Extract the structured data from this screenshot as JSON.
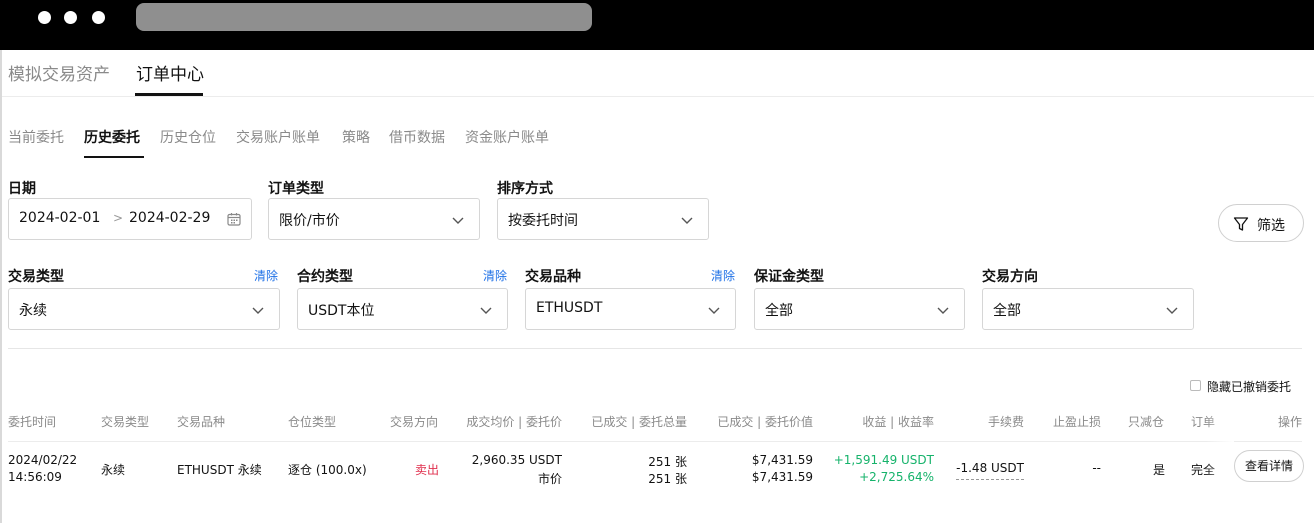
{
  "main_tabs": [
    {
      "label": "模拟交易资产",
      "active": false
    },
    {
      "label": "订单中心",
      "active": true
    }
  ],
  "sub_tabs": [
    {
      "label": "当前委托",
      "active": false
    },
    {
      "label": "历史委托",
      "active": true
    },
    {
      "label": "历史仓位",
      "active": false
    },
    {
      "label": "交易账户账单",
      "active": false
    },
    {
      "label": "策略",
      "active": false
    },
    {
      "label": "借币数据",
      "active": false
    },
    {
      "label": "资金账户账单",
      "active": false
    }
  ],
  "filters": {
    "date": {
      "label": "日期",
      "start": "2024-02-01",
      "separator": ">",
      "end": "2024-02-29",
      "icon": "calendar-icon"
    },
    "order_type": {
      "label": "订单类型",
      "value": "限价/市价"
    },
    "sort": {
      "label": "排序方式",
      "value": "按委托时间"
    },
    "filter_button": {
      "label": "筛选",
      "icon": "filter-icon"
    },
    "trade_type": {
      "label": "交易类型",
      "clear": "清除",
      "value": "永续"
    },
    "contract_type": {
      "label": "合约类型",
      "clear": "清除",
      "value": "USDT本位"
    },
    "instrument": {
      "label": "交易品种",
      "clear": "清除",
      "value": "ETHUSDT"
    },
    "margin_type": {
      "label": "保证金类型",
      "value": "全部"
    },
    "direction": {
      "label": "交易方向",
      "value": "全部"
    }
  },
  "hide_cancelled": {
    "label": "隐藏已撤销委托",
    "checked": false
  },
  "table": {
    "headers": {
      "time": "委托时间",
      "trade_type": "交易类型",
      "instrument": "交易品种",
      "position_type": "仓位类型",
      "direction": "交易方向",
      "price": "成交均价 | 委托价",
      "amount": "已成交 | 委托总量",
      "value": "已成交 | 委托价值",
      "pnl": "收益 | 收益率",
      "fee": "手续费",
      "tpsl": "止盈止损",
      "reduce_only": "只减仓",
      "status": "订单",
      "action": "操作"
    },
    "rows": [
      {
        "date": "2024/02/22",
        "time": "14:56:09",
        "trade_type": "永续",
        "instrument": "ETHUSDT 永续",
        "position_type": "逐仓 (100.0x)",
        "direction": "卖出",
        "avg_price": "2,960.35 USDT",
        "order_price": "市价",
        "filled": "251 张",
        "total": "251 张",
        "filled_value": "$7,431.59",
        "order_value": "$7,431.59",
        "pnl": "+1,591.49 USDT",
        "pnl_rate": "+2,725.64%",
        "fee": "-1.48 USDT",
        "tpsl": "--",
        "reduce_only": "是",
        "status": "完全成交",
        "action": "查看详情"
      }
    ]
  },
  "colors": {
    "sell": "#e0304e",
    "gain": "#16b36b",
    "link": "#1e70e6"
  }
}
